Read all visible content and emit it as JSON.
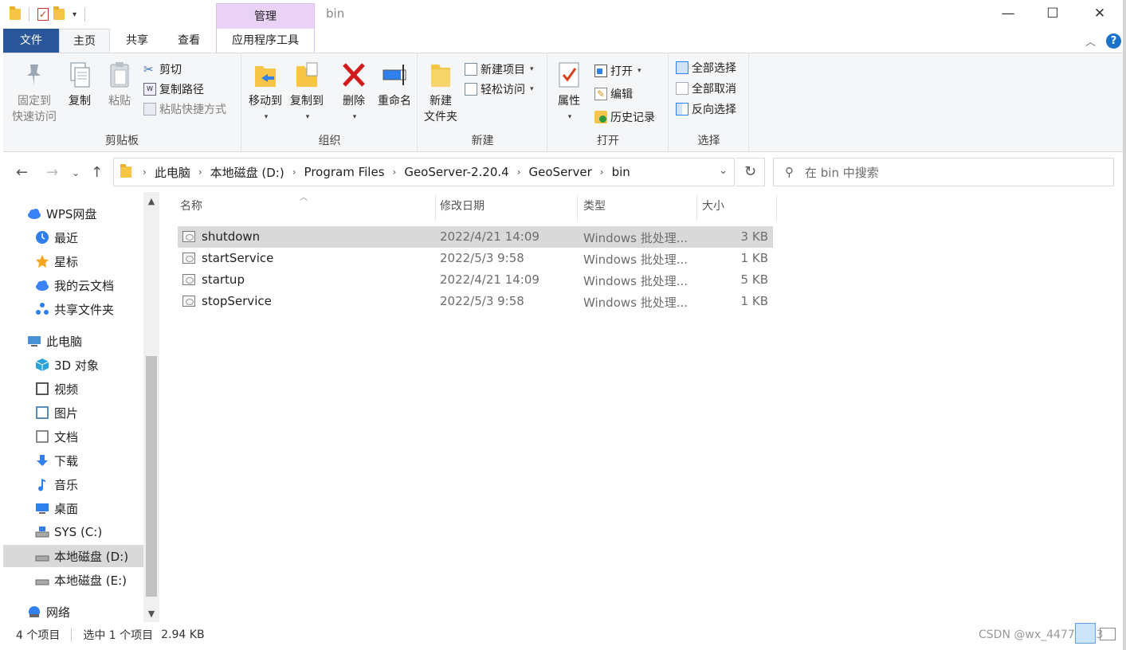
{
  "window": {
    "title": "bin",
    "manage_tab": "管理",
    "minimize": "—",
    "maximize": "☐",
    "close": "✕"
  },
  "ribbon_tabs": {
    "file": "文件",
    "home": "主页",
    "share": "共享",
    "view": "查看",
    "app_tools": "应用程序工具"
  },
  "ribbon": {
    "clipboard": {
      "label": "剪贴板",
      "pin_line1": "固定到",
      "pin_line2": "快速访问",
      "copy": "复制",
      "paste": "粘贴",
      "cut": "剪切",
      "copy_path": "复制路径",
      "paste_shortcut": "粘贴快捷方式"
    },
    "organize": {
      "label": "组织",
      "move_to": "移动到",
      "copy_to": "复制到",
      "delete": "删除",
      "rename": "重命名"
    },
    "new": {
      "label": "新建",
      "new_folder_line1": "新建",
      "new_folder_line2": "文件夹",
      "new_item": "新建项目",
      "easy_access": "轻松访问"
    },
    "open": {
      "label": "打开",
      "properties": "属性",
      "open": "打开",
      "edit": "编辑",
      "history": "历史记录"
    },
    "select": {
      "label": "选择",
      "select_all": "全部选择",
      "select_none": "全部取消",
      "invert": "反向选择"
    }
  },
  "address": {
    "breadcrumbs": [
      "此电脑",
      "本地磁盘 (D:)",
      "Program Files",
      "GeoServer-2.20.4",
      "GeoServer",
      "bin"
    ],
    "search_placeholder": "在 bin 中搜索"
  },
  "nav": {
    "items": [
      {
        "label": "WPS网盘",
        "icon": "cloud-icon",
        "color": "#3b82f6"
      },
      {
        "label": "最近",
        "icon": "clock-icon",
        "color": "#2f80ed"
      },
      {
        "label": "星标",
        "icon": "star-icon",
        "color": "#f5a623"
      },
      {
        "label": "我的云文档",
        "icon": "cloud-doc-icon",
        "color": "#3b82f6"
      },
      {
        "label": "共享文件夹",
        "icon": "share-folder-icon",
        "color": "#2f80ed"
      },
      {
        "label": "此电脑",
        "icon": "computer-icon",
        "color": "#4a90d9"
      },
      {
        "label": "3D 对象",
        "icon": "cube-icon",
        "color": "#29a3d9"
      },
      {
        "label": "视频",
        "icon": "film-icon",
        "color": "#555555"
      },
      {
        "label": "图片",
        "icon": "picture-icon",
        "color": "#5b8db8"
      },
      {
        "label": "文档",
        "icon": "document-icon",
        "color": "#8a8a8a"
      },
      {
        "label": "下载",
        "icon": "download-arrow-icon",
        "color": "#2f80ed"
      },
      {
        "label": "音乐",
        "icon": "music-note-icon",
        "color": "#2f80ed"
      },
      {
        "label": "桌面",
        "icon": "desktop-icon",
        "color": "#2f80ed"
      },
      {
        "label": "SYS (C:)",
        "icon": "windows-drive-icon",
        "color": "#2f80ed"
      },
      {
        "label": "本地磁盘 (D:)",
        "icon": "drive-icon",
        "color": "#777777"
      },
      {
        "label": "本地磁盘 (E:)",
        "icon": "drive-icon",
        "color": "#777777"
      },
      {
        "label": "网络",
        "icon": "network-icon",
        "color": "#2f80ed"
      }
    ]
  },
  "file_list": {
    "columns": {
      "name": "名称",
      "date": "修改日期",
      "type": "类型",
      "size": "大小"
    },
    "rows": [
      {
        "name": "shutdown",
        "date": "2022/4/21 14:09",
        "type": "Windows 批处理...",
        "size": "3 KB"
      },
      {
        "name": "startService",
        "date": "2022/5/3 9:58",
        "type": "Windows 批处理...",
        "size": "1 KB"
      },
      {
        "name": "startup",
        "date": "2022/4/21 14:09",
        "type": "Windows 批处理...",
        "size": "5 KB"
      },
      {
        "name": "stopService",
        "date": "2022/5/3 9:58",
        "type": "Windows 批处理...",
        "size": "1 KB"
      }
    ]
  },
  "status": {
    "item_count": "4 个项目",
    "selection": "选中 1 个项目",
    "selection_size": "2.94 KB",
    "watermark": "CSDN @wx_44778303"
  }
}
